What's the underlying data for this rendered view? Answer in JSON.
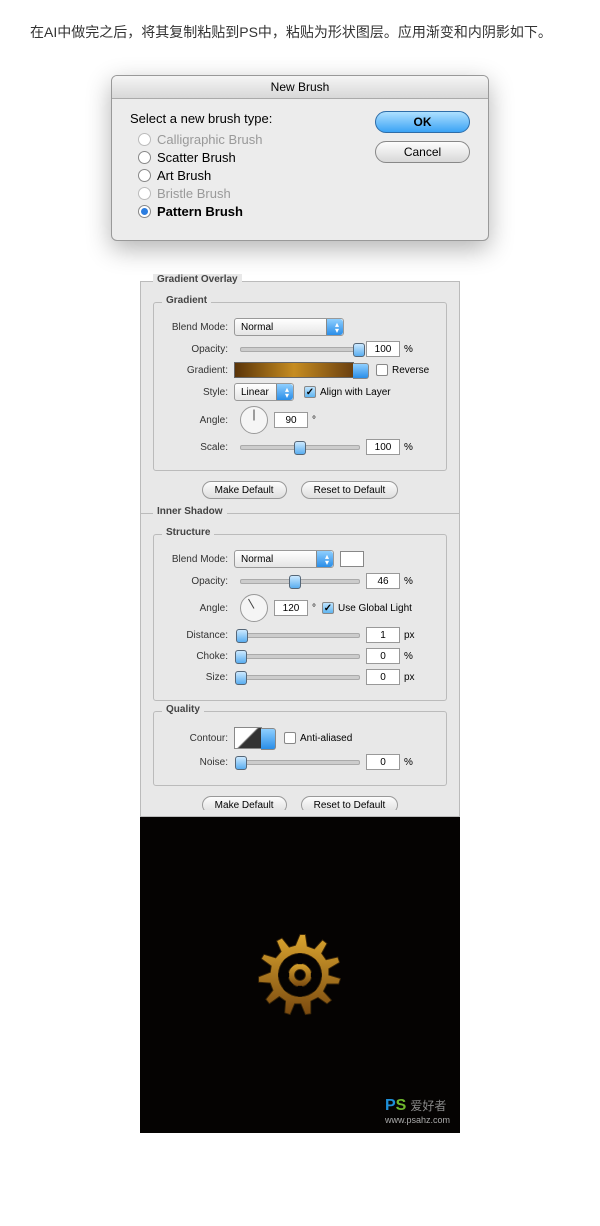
{
  "intro_text": "在AI中做完之后，将其复制粘贴到PS中，粘贴为形状图层。应用渐变和内阴影如下。",
  "new_brush": {
    "title": "New Brush",
    "prompt": "Select a new brush type:",
    "options": [
      {
        "label": "Calligraphic Brush",
        "disabled": true,
        "checked": false
      },
      {
        "label": "Scatter Brush",
        "disabled": false,
        "checked": false
      },
      {
        "label": "Art Brush",
        "disabled": false,
        "checked": false
      },
      {
        "label": "Bristle Brush",
        "disabled": true,
        "checked": false
      },
      {
        "label": "Pattern Brush",
        "disabled": false,
        "checked": true
      }
    ],
    "ok": "OK",
    "cancel": "Cancel"
  },
  "gradient_overlay": {
    "title": "Gradient Overlay",
    "gradient_legend": "Gradient",
    "blend_mode_label": "Blend Mode:",
    "blend_mode_value": "Normal",
    "opacity_label": "Opacity:",
    "opacity_value": "100",
    "opacity_unit": "%",
    "gradient_label": "Gradient:",
    "reverse_label": "Reverse",
    "style_label": "Style:",
    "style_value": "Linear",
    "align_label": "Align with Layer",
    "angle_label": "Angle:",
    "angle_value": "90",
    "angle_unit": "°",
    "scale_label": "Scale:",
    "scale_value": "100",
    "scale_unit": "%",
    "make_default": "Make Default",
    "reset_default": "Reset to Default"
  },
  "inner_shadow": {
    "title": "Inner Shadow",
    "structure_legend": "Structure",
    "blend_mode_label": "Blend Mode:",
    "blend_mode_value": "Normal",
    "opacity_label": "Opacity:",
    "opacity_value": "46",
    "opacity_unit": "%",
    "angle_label": "Angle:",
    "angle_value": "120",
    "angle_unit": "°",
    "global_light_label": "Use Global Light",
    "distance_label": "Distance:",
    "distance_value": "1",
    "distance_unit": "px",
    "choke_label": "Choke:",
    "choke_value": "0",
    "choke_unit": "%",
    "size_label": "Size:",
    "size_value": "0",
    "size_unit": "px",
    "quality_legend": "Quality",
    "contour_label": "Contour:",
    "antialiased_label": "Anti-aliased",
    "noise_label": "Noise:",
    "noise_value": "0",
    "noise_unit": "%",
    "make_default": "Make Default",
    "reset_default": "Reset to Default"
  },
  "watermark": {
    "p": "P",
    "s": "S",
    "text": "爱好者",
    "url": "www.psahz.com"
  }
}
